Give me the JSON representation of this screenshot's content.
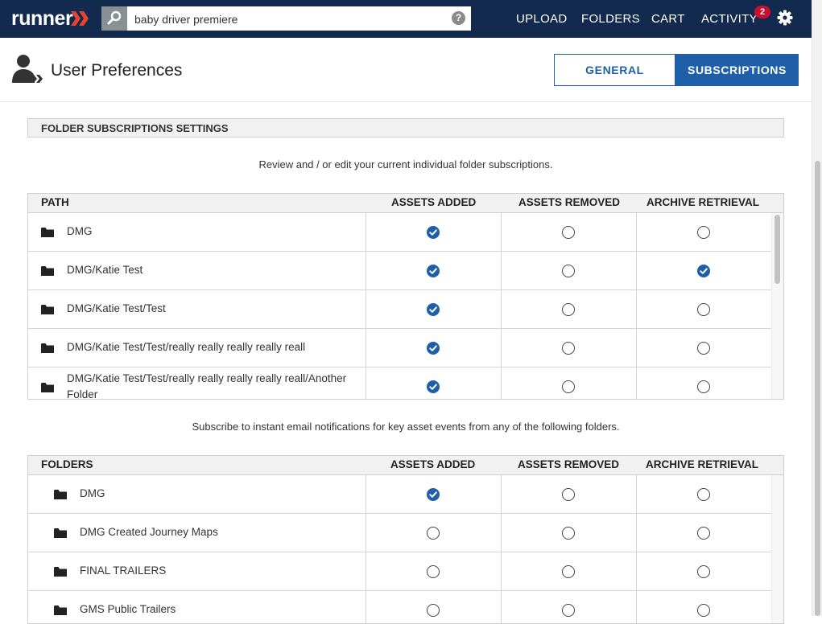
{
  "app": {
    "brand": "runner"
  },
  "search": {
    "value": "baby driver premiere",
    "help": "?"
  },
  "nav": {
    "upload": "UPLOAD",
    "folders": "FOLDERS",
    "cart": "CART",
    "activity": "ACTIVITY",
    "activity_count": "2"
  },
  "header": {
    "title": "User Preferences"
  },
  "tabs": {
    "general": "GENERAL",
    "subscriptions": "SUBSCRIPTIONS",
    "active": "subscriptions"
  },
  "section": {
    "title": "FOLDER SUBSCRIPTIONS SETTINGS"
  },
  "current": {
    "caption": "Review and / or edit your current individual folder subscriptions.",
    "headers": [
      "PATH",
      "ASSETS ADDED",
      "ASSETS REMOVED",
      "ARCHIVE RETRIEVAL"
    ],
    "rows": [
      {
        "path": "DMG",
        "added": true,
        "removed": false,
        "archive": false
      },
      {
        "path": "DMG/Katie Test",
        "added": true,
        "removed": false,
        "archive": true
      },
      {
        "path": "DMG/Katie Test/Test",
        "added": true,
        "removed": false,
        "archive": false
      },
      {
        "path": "DMG/Katie Test/Test/really really really really reall",
        "added": true,
        "removed": false,
        "archive": false
      },
      {
        "path": "DMG/Katie Test/Test/really really really really reall/Another Folder",
        "added": true,
        "removed": false,
        "archive": false
      }
    ]
  },
  "available": {
    "caption": "Subscribe to instant email notifications for key asset events from any of the following folders.",
    "headers": [
      "FOLDERS",
      "ASSETS ADDED",
      "ASSETS REMOVED",
      "ARCHIVE RETRIEVAL"
    ],
    "rows": [
      {
        "path": "DMG",
        "added": true,
        "removed": false,
        "archive": false
      },
      {
        "path": "DMG Created Journey Maps",
        "added": false,
        "removed": false,
        "archive": false
      },
      {
        "path": "FINAL TRAILERS",
        "added": false,
        "removed": false,
        "archive": false
      },
      {
        "path": "GMS Public Trailers",
        "added": false,
        "removed": false,
        "archive": false
      }
    ]
  },
  "colors": {
    "navbar": "#112a4d",
    "accent": "#1f5fa8",
    "badge": "#c8102e"
  }
}
